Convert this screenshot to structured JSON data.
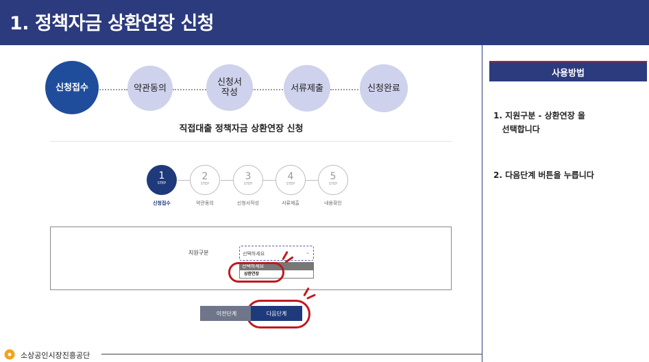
{
  "header": {
    "title": "1. 정책자금 상환연장 신청"
  },
  "progress_steps": [
    {
      "label": "신청접수",
      "state": "active"
    },
    {
      "label": "약관동의",
      "state": "inactive"
    },
    {
      "label": "신청서\n작성",
      "state": "inactive"
    },
    {
      "label": "서류제출",
      "state": "inactive"
    },
    {
      "label": "신청완료",
      "state": "inactive"
    }
  ],
  "subtitle": "직접대출 정책자금 상환연장 신청",
  "step_indicator": {
    "step_text": "STEP",
    "steps": [
      {
        "num": "1",
        "label": "신청접수"
      },
      {
        "num": "2",
        "label": "약관동의"
      },
      {
        "num": "3",
        "label": "신청서작성"
      },
      {
        "num": "4",
        "label": "서류제출"
      },
      {
        "num": "5",
        "label": "내용확인"
      }
    ]
  },
  "form": {
    "field_label": "지원구분",
    "select_value": "선택하세요",
    "options": [
      "선택하세요",
      "상환연장"
    ]
  },
  "buttons": {
    "prev": "이전단계",
    "next": "다음단계"
  },
  "footer": {
    "org": "소상공인시장진흥공단"
  },
  "usage": {
    "title": "사용방법",
    "instructions": [
      "1. 지원구분 - 상환연장 을\n   선택합니다",
      "2. 다음단계 버튼을 누릅니다"
    ]
  },
  "colors": {
    "header_bg": "#2c3a7e",
    "active_step": "#1f4d9c",
    "highlight": "#c0181e"
  }
}
